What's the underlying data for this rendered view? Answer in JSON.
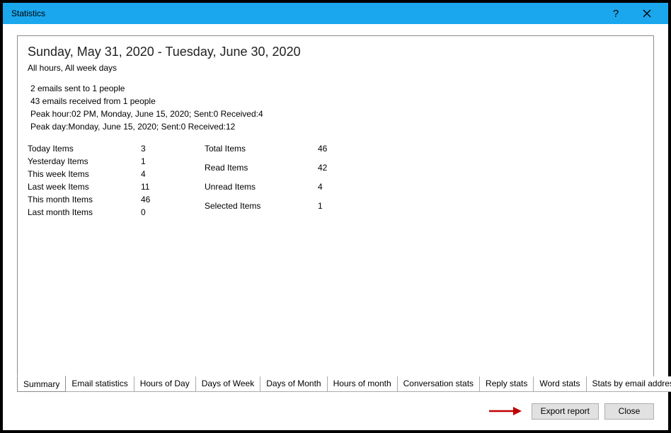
{
  "window": {
    "title": "Statistics"
  },
  "header": {
    "date_range": "Sunday, May 31, 2020 - Tuesday, June 30, 2020",
    "filter": "All hours, All week days"
  },
  "meta": {
    "line1": "2 emails sent to 1 people",
    "line2": "43 emails received from 1 people",
    "line3": "Peak hour:02 PM, Monday, June 15, 2020; Sent:0 Received:4",
    "line4": "Peak day:Monday, June 15, 2020; Sent:0 Received:12"
  },
  "stats_left": [
    {
      "label": "Today Items",
      "value": "3"
    },
    {
      "label": "Yesterday Items",
      "value": "1"
    },
    {
      "label": "This week Items",
      "value": "4"
    },
    {
      "label": "Last week Items",
      "value": "11"
    },
    {
      "label": "This month Items",
      "value": "46"
    },
    {
      "label": "Last month Items",
      "value": "0"
    }
  ],
  "stats_right": [
    {
      "label": "Total Items",
      "value": "46"
    },
    {
      "label": "Read Items",
      "value": "42"
    },
    {
      "label": "Unread Items",
      "value": "4"
    },
    {
      "label": "Selected Items",
      "value": "1"
    }
  ],
  "tabs": [
    "Summary",
    "Email statistics",
    "Hours of Day",
    "Days of Week",
    "Days of Month",
    "Hours of month",
    "Conversation stats",
    "Reply stats",
    "Word stats",
    "Stats by email address"
  ],
  "active_tab": "Summary",
  "buttons": {
    "export": "Export report",
    "close": "Close"
  }
}
